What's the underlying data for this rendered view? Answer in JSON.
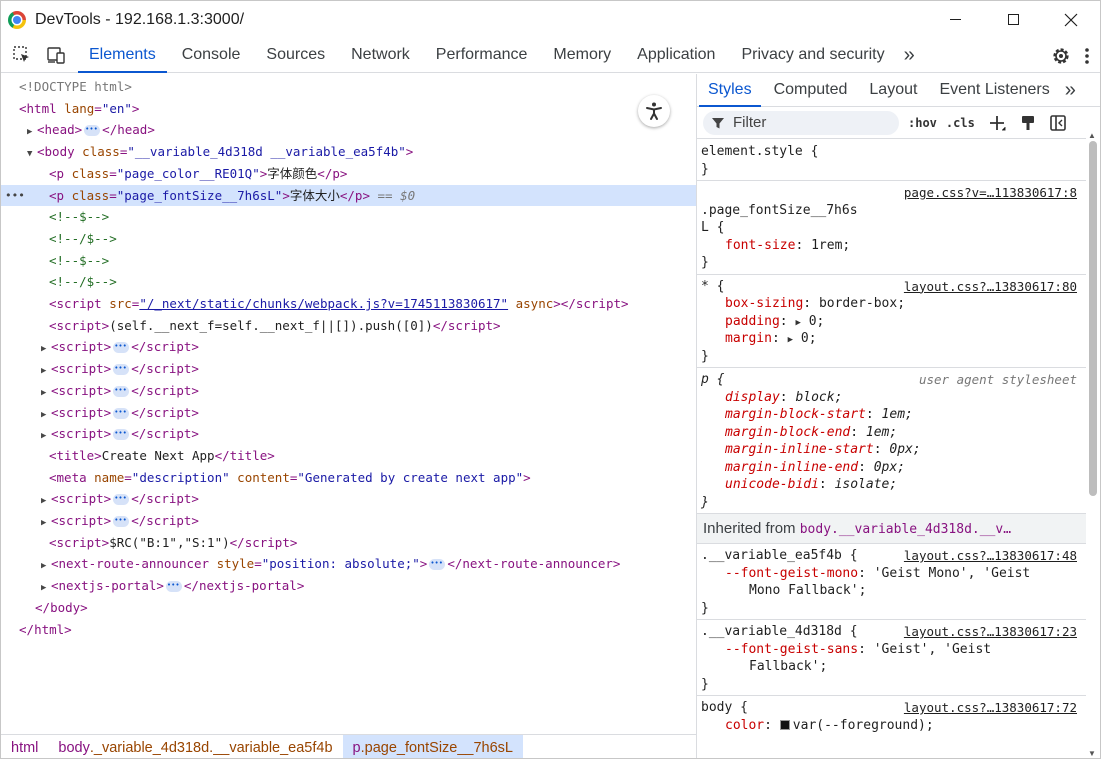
{
  "window": {
    "title": "DevTools - 192.168.1.3:3000/"
  },
  "toolbar": {
    "tabs": [
      "Elements",
      "Console",
      "Sources",
      "Network",
      "Performance",
      "Memory",
      "Application",
      "Privacy and security"
    ],
    "more": "»"
  },
  "dom": {
    "doctype": "<!DOCTYPE html>",
    "html_open": "html",
    "html_attr": "lang",
    "html_val": "\"en\"",
    "head": "head",
    "body_tag": "body",
    "body_attr": "class",
    "body_val": "\"__variable_4d318d __variable_ea5f4b\"",
    "p1_attr_val": "\"page_color__RE01Q\"",
    "p1_text": "字体颜色",
    "p2_attr_val": "\"page_fontSize__7h6sL\"",
    "p2_text": "字体大小",
    "p2_marker": "== $0",
    "c1": "<!--$-->",
    "c2": "<!--/$-->",
    "c3": "<!--$-->",
    "c4": "<!--/$-->",
    "script_src": "\"/_next/static/chunks/webpack.js?v=1745113830617\"",
    "script_async": "async",
    "script_inline": "(self.__next_f=self.__next_f||[]).push([0])",
    "title_text": "Create Next App",
    "meta_name_val": "\"description\"",
    "meta_content_val": "\"Generated by create next app\"",
    "rc_text": "$RC(\"B:1\",\"S:1\")",
    "nra_style_val": "\"position: absolute;\"",
    "nra_tag": "next-route-announcer",
    "portal_tag": "nextjs-portal"
  },
  "breadcrumb": {
    "items": [
      "html",
      "body",
      "p"
    ],
    "classes": [
      "",
      "._variable_4d318d.__variable_ea5f4b",
      ".page_fontSize__7h6sL"
    ]
  },
  "styles": {
    "tabs": [
      "Styles",
      "Computed",
      "Layout",
      "Event Listeners"
    ],
    "filter_placeholder": "Filter",
    "hov": ":hov",
    "cls": ".cls",
    "element_style": "element.style {",
    "rule1": {
      "selector_a": ".page_fontSize__7h6s",
      "selector_b": "L {",
      "source": "page.css?v=…113830617:8",
      "prop": "font-size",
      "value": "1rem;"
    },
    "rule2": {
      "selector": "* {",
      "source": "layout.css?…13830617:80",
      "props": [
        [
          "box-sizing",
          "border-box;"
        ],
        [
          "padding",
          "0;"
        ],
        [
          "margin",
          "0;"
        ]
      ]
    },
    "rule3": {
      "selector": "p {",
      "source": "user agent stylesheet",
      "props": [
        [
          "display",
          "block;"
        ],
        [
          "margin-block-start",
          "1em;"
        ],
        [
          "margin-block-end",
          "1em;"
        ],
        [
          "margin-inline-start",
          "0px;"
        ],
        [
          "margin-inline-end",
          "0px;"
        ],
        [
          "unicode-bidi",
          "isolate;"
        ]
      ]
    },
    "inherited_label": "Inherited from",
    "inherited_sel": "body.__variable_4d318d.__v…",
    "rule4": {
      "selector": ".__variable_ea5f4b {",
      "source": "layout.css?…13830617:48",
      "var": "--font-geist-mono",
      "value_a": "'Geist Mono', 'Geist",
      "value_b": "Mono Fallback';"
    },
    "rule5": {
      "selector": ".__variable_4d318d {",
      "source": "layout.css?…13830617:23",
      "var": "--font-geist-sans",
      "value_a": "'Geist', 'Geist",
      "value_b": "Fallback';"
    },
    "rule6": {
      "selector": "body {",
      "source": "layout.css?…13830617:72",
      "prop": "color",
      "value": "var(--foreground);"
    }
  }
}
